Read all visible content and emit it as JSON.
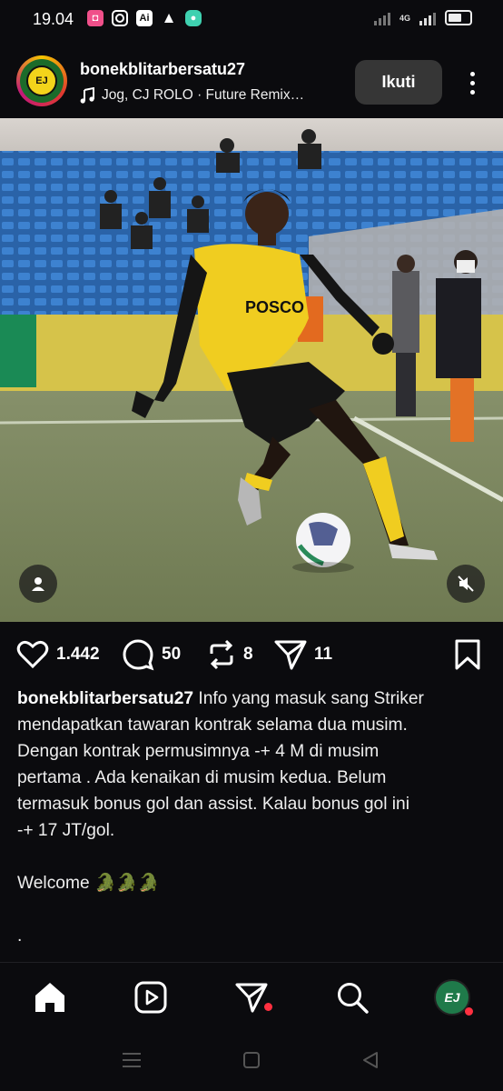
{
  "status_bar": {
    "time": "19.04",
    "network": "4G",
    "notification_icons": [
      "app-notification-icon",
      "instagram-icon",
      "ai-icon",
      "warning-icon",
      "chat-icon"
    ]
  },
  "post": {
    "username": "bonekblitarbersatu27",
    "music": "Jog, CJ ROLO · Future Remix…",
    "follow_label": "Ikuti",
    "media_description_icons": [
      "user-tag-icon",
      "muted-speaker-icon"
    ]
  },
  "actions": {
    "likes": "1.442",
    "comments": "50",
    "reposts": "8",
    "shares": "11"
  },
  "caption": {
    "username": "bonekblitarbersatu27",
    "text_lines": [
      " Info yang masuk sang Striker",
      "mendapatkan tawaran kontrak selama dua musim.",
      "Dengan kontrak permusimnya -+ 4 M di musim",
      "pertama . Ada kenaikan di musim kedua. Belum",
      "termasuk bonus gol dan assist. Kalau bonus gol ini",
      "-+ 17 JT/gol."
    ],
    "welcome": "Welcome 🐊🐊🐊",
    "dot": "."
  },
  "bottom_nav": {
    "items": [
      "home-icon",
      "reels-icon",
      "direct-message-icon",
      "search-icon",
      "profile-avatar"
    ],
    "profile_initials": "EJ"
  },
  "colors": {
    "background": "#0b0b0e",
    "follow_button": "#363636",
    "notification_dot": "#ff3040",
    "jersey_yellow": "#f3d41b"
  }
}
